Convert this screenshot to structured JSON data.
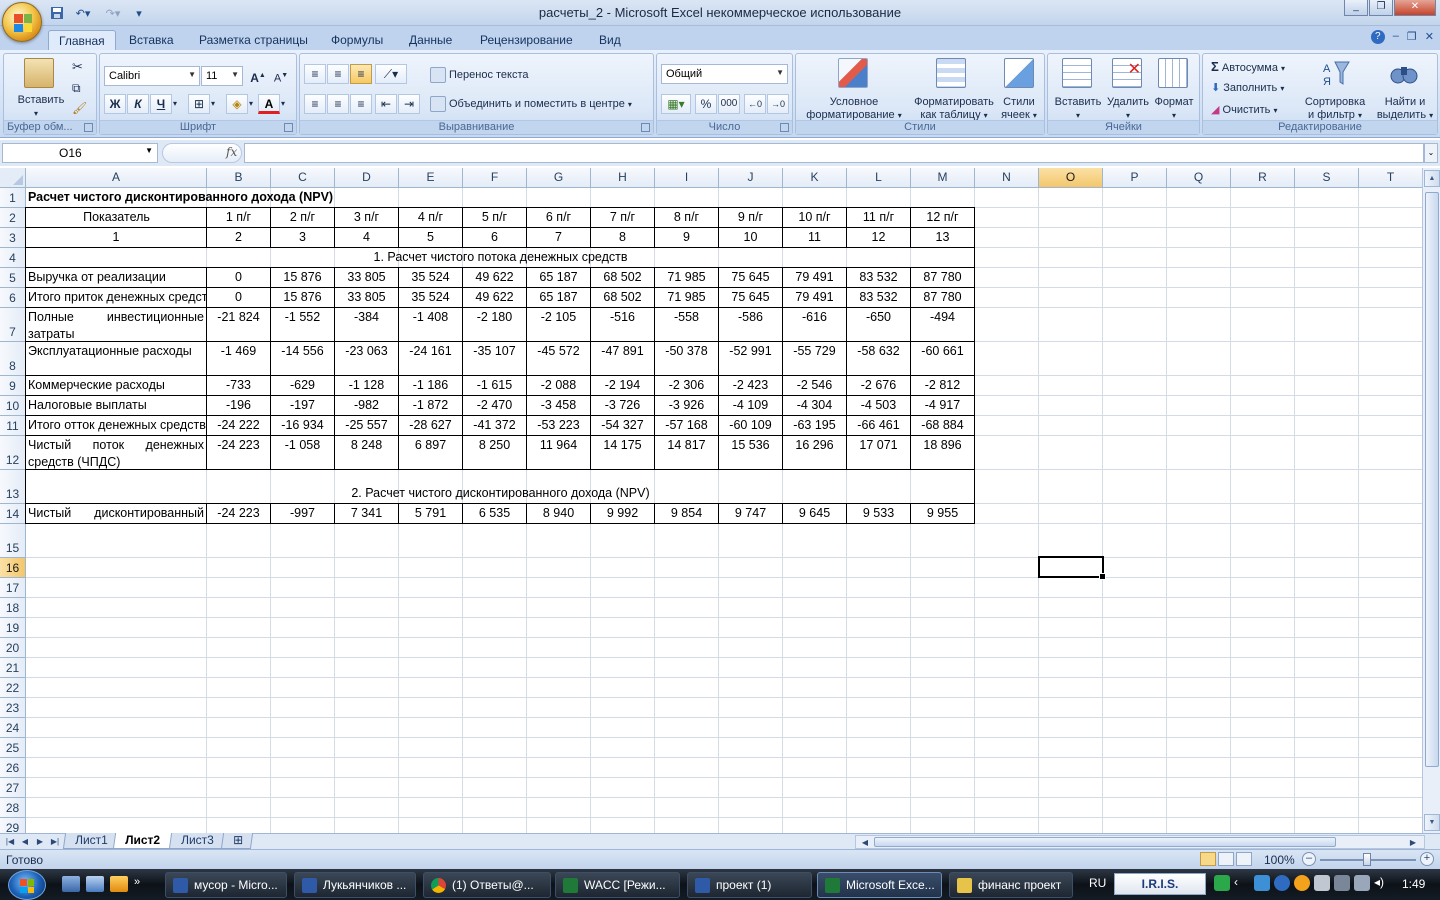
{
  "window": {
    "title": "расчеты_2 - Microsoft Excel некоммерческое использование"
  },
  "ribbon_tabs": [
    "Главная",
    "Вставка",
    "Разметка страницы",
    "Формулы",
    "Данные",
    "Рецензирование",
    "Вид"
  ],
  "ribbon": {
    "clipboard": {
      "paste": "Вставить",
      "label": "Буфер обм..."
    },
    "font": {
      "name": "Calibri",
      "size": "11",
      "bold": "Ж",
      "italic": "К",
      "underline": "Ч",
      "label": "Шрифт"
    },
    "alignment": {
      "wrap": "Перенос текста",
      "merge": "Объединить и поместить в центре",
      "label": "Выравнивание"
    },
    "number": {
      "format": "Общий",
      "percent": "%",
      "thousands": "000",
      "label": "Число"
    },
    "styles": {
      "conditional": "Условное\nформатирование",
      "as_table": "Форматировать\nкак таблицу",
      "cell_styles": "Стили\nячеек",
      "label": "Стили"
    },
    "cells": {
      "insert": "Вставить",
      "delete": "Удалить",
      "format": "Формат",
      "label": "Ячейки"
    },
    "editing": {
      "autosum": "Автосумма",
      "fill": "Заполнить",
      "clear": "Очистить",
      "sort": "Сортировка\nи фильтр",
      "find": "Найти и\nвыделить",
      "label": "Редактирование"
    }
  },
  "formula_bar": {
    "name_box": "O16",
    "fx": "fx",
    "formula": ""
  },
  "columns": [
    "A",
    "B",
    "C",
    "D",
    "E",
    "F",
    "G",
    "H",
    "I",
    "J",
    "K",
    "L",
    "M",
    "N",
    "O",
    "P",
    "Q",
    "R",
    "S",
    "T"
  ],
  "selected_column": "O",
  "selected_row": "16",
  "sheet": {
    "title": "Расчет чистого дисконтированного дохода (NPV)",
    "header_label": "Показатель",
    "periods": [
      "1 п/г",
      "2 п/г",
      "3 п/г",
      "4 п/г",
      "5 п/г",
      "6 п/г",
      "7 п/г",
      "8 п/г",
      "9 п/г",
      "10 п/г",
      "11 п/г",
      "12 п/г"
    ],
    "numbering": [
      "1",
      "2",
      "3",
      "4",
      "5",
      "6",
      "7",
      "8",
      "9",
      "10",
      "11",
      "12",
      "13"
    ],
    "section1": "1. Расчет чистого потока денежных средств",
    "section2": "2. Расчет чистого дисконтированного дохода (NPV)",
    "rows": [
      {
        "label": "Выручка от реализации",
        "values": [
          "0",
          "15 876",
          "33 805",
          "35 524",
          "49 622",
          "65 187",
          "68 502",
          "71 985",
          "75 645",
          "79 491",
          "83 532",
          "87 780"
        ]
      },
      {
        "label": "Итого приток денежных средств",
        "values": [
          "0",
          "15 876",
          "33 805",
          "35 524",
          "49 622",
          "65 187",
          "68 502",
          "71 985",
          "75 645",
          "79 491",
          "83 532",
          "87 780"
        ]
      },
      {
        "label": "Полные инвестиционные затраты",
        "values": [
          "-21 824",
          "-1 552",
          "-384",
          "-1 408",
          "-2 180",
          "-2 105",
          "-516",
          "-558",
          "-586",
          "-616",
          "-650",
          "-494"
        ]
      },
      {
        "label": "Эксплуатационные расходы",
        "values": [
          "-1 469",
          "-14 556",
          "-23 063",
          "-24 161",
          "-35 107",
          "-45 572",
          "-47 891",
          "-50 378",
          "-52 991",
          "-55 729",
          "-58 632",
          "-60 661"
        ]
      },
      {
        "label": "Коммерческие расходы",
        "values": [
          "-733",
          "-629",
          "-1 128",
          "-1 186",
          "-1 615",
          "-2 088",
          "-2 194",
          "-2 306",
          "-2 423",
          "-2 546",
          "-2 676",
          "-2 812"
        ]
      },
      {
        "label": "Налоговые выплаты",
        "values": [
          "-196",
          "-197",
          "-982",
          "-1 872",
          "-2 470",
          "-3 458",
          "-3 726",
          "-3 926",
          "-4 109",
          "-4 304",
          "-4 503",
          "-4 917"
        ]
      },
      {
        "label": "Итого отток денежных средств",
        "values": [
          "-24 222",
          "-16 934",
          "-25 557",
          "-28 627",
          "-41 372",
          "-53 223",
          "-54 327",
          "-57 168",
          "-60 109",
          "-63 195",
          "-66 461",
          "-68 884"
        ]
      },
      {
        "label": "Чистый поток денежных средств (ЧПДС)",
        "values": [
          "-24 223",
          "-1 058",
          "8 248",
          "6 897",
          "8 250",
          "11 964",
          "14 175",
          "14 817",
          "15 536",
          "16 296",
          "17 071",
          "18 896"
        ]
      }
    ],
    "npv_row": {
      "label": "Чистый дисконтированный доход (NPV)",
      "values": [
        "-24 223",
        "-997",
        "7 341",
        "5 791",
        "6 535",
        "8 940",
        "9 992",
        "9 854",
        "9 747",
        "9 645",
        "9 533",
        "9 955"
      ]
    }
  },
  "sheet_tabs": [
    "Лист1",
    "Лист2",
    "Лист3"
  ],
  "active_sheet": "Лист2",
  "status": {
    "text": "Готово",
    "zoom": "100%"
  },
  "taskbar": {
    "items": [
      "мусор - Micro...",
      "Лукьянчиков ...",
      "(1) Ответы@...",
      "WACC  [Режи...",
      "проект (1)",
      "Microsoft Exce...",
      "финанс проект"
    ],
    "active_index": 5,
    "lang": "RU",
    "iris": "I.R.I.S.",
    "clock": "1:49"
  }
}
